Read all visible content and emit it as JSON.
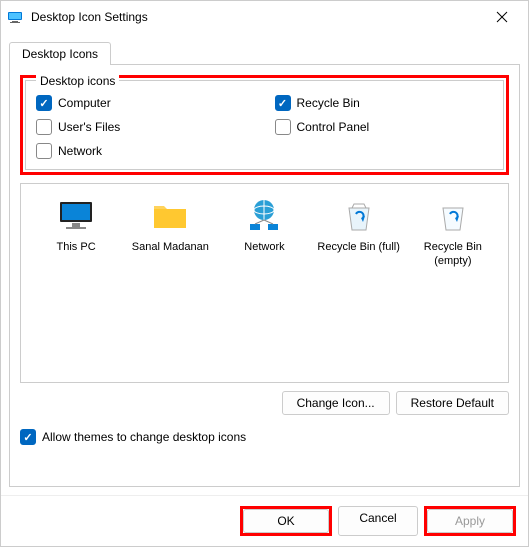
{
  "window": {
    "title": "Desktop Icon Settings"
  },
  "tab": {
    "label": "Desktop Icons"
  },
  "fieldset": {
    "legend": "Desktop icons"
  },
  "checkboxes": {
    "computer": "Computer",
    "recyclebin": "Recycle Bin",
    "usersfiles": "User's Files",
    "controlpanel": "Control Panel",
    "network": "Network"
  },
  "icons": {
    "thispc": "This PC",
    "user": "Sanal Madanan",
    "network": "Network",
    "rb_full": "Recycle Bin (full)",
    "rb_empty": "Recycle Bin (empty)"
  },
  "buttons": {
    "changeicon": "Change Icon...",
    "restore": "Restore Default",
    "ok": "OK",
    "cancel": "Cancel",
    "apply": "Apply"
  },
  "allow": {
    "label": "Allow themes to change desktop icons"
  }
}
